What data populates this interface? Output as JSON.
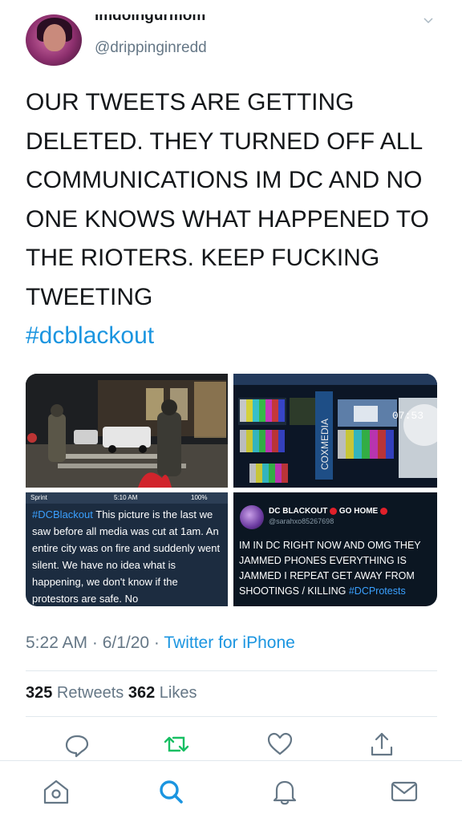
{
  "tweet": {
    "display_name": "imdoingurmom",
    "handle": "@drippinginredd",
    "text": "OUR TWEETS ARE GETTING DELETED. THEY TURNED OFF ALL COMMUNICATIONS IM DC AND NO ONE KNOWS WHAT HAPPENED TO THE RIOTERS. KEEP FUCKING TWEETING",
    "hashtag": "#dcblackout",
    "timestamp": "5:22 AM · 6/1/20 · ",
    "source": "Twitter for iPhone",
    "retweets_count": "325",
    "retweets_label": " Retweets  ",
    "likes_count": "362",
    "likes_label": " Likes"
  },
  "media": {
    "image3": {
      "status_carrier": "Sprint",
      "status_time": "5:10 AM",
      "status_battery": "100%",
      "hashtag": "#DCBlackout",
      "text": " This picture is the last we saw before all media was cut at 1am. An entire city was on fire and suddenly went silent. We have no idea what is happening, we don't know if the protestors are safe. No"
    },
    "image2": {
      "clock": "07:53",
      "brand": "COXMEDIA"
    },
    "image4": {
      "name": "DC BLACKOUT",
      "name_suffix": "GO HOME",
      "handle": "@sarahxo85267698",
      "text": "IM IN DC RIGHT NOW AND OMG THEY JAMMED PHONES EVERYTHING IS JAMMED I REPEAT GET AWAY FROM SHOOTINGS / KILLING ",
      "hashtag": "#DCProtests"
    }
  },
  "colors": {
    "accent": "#1b95e0",
    "retweet": "#17bf63",
    "secondary_text": "#657786"
  },
  "actions": [
    "reply-icon",
    "retweet-icon",
    "like-icon",
    "share-icon"
  ],
  "tabs": [
    "home-icon",
    "search-icon",
    "notifications-icon",
    "messages-icon"
  ]
}
